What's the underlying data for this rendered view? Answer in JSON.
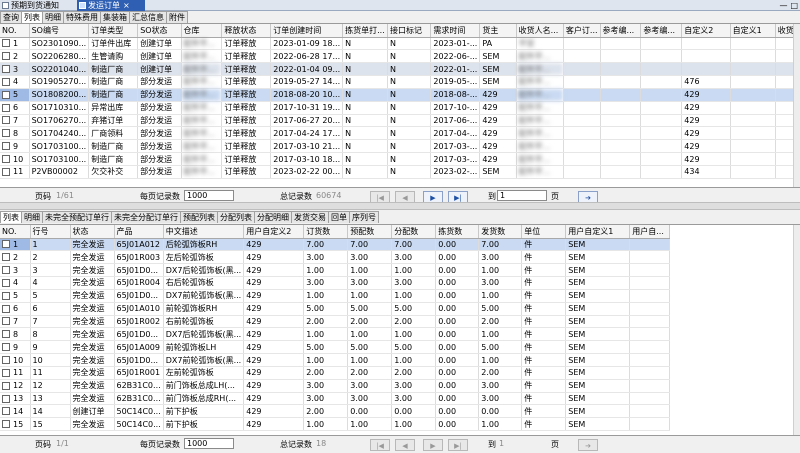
{
  "doc_tabs": [
    {
      "label": "预期到货通知",
      "active": false
    },
    {
      "label": "发运订单",
      "active": true
    }
  ],
  "top_subtabs": [
    "查询",
    "列表",
    "明细",
    "特殊费用",
    "集装箱",
    "汇总信息",
    "附件"
  ],
  "top_grid": {
    "columns": [
      "NO.",
      "SO编号",
      "订单类型",
      "SO状态",
      "仓库",
      "释放状态",
      "订单创建时间",
      "拣货单打...",
      "接口标记",
      "需求时间",
      "货主",
      "收货人名...",
      "客户订...",
      "参考编...",
      "参考编...",
      "自定义2",
      "自定义1",
      "收货"
    ],
    "rows": [
      [
        "1",
        "SO2301090...",
        "订单件出库",
        "创建订单",
        "配件平...",
        "订单释放",
        "2023-01-09 18...",
        "N",
        "N",
        "2023-01-...",
        "PA",
        "平安",
        "",
        "",
        "",
        "",
        "",
        ""
      ],
      [
        "2",
        "SO2206280...",
        "生管请购",
        "创建订单",
        "配件平...",
        "订单释放",
        "2022-06-28 17...",
        "N",
        "N",
        "2022-06-...",
        "SEM",
        "配件平...",
        "",
        "",
        "",
        "",
        "",
        ""
      ],
      [
        "3",
        "SO2201040...",
        "制造厂商",
        "创建订单",
        "配件平...",
        "订单释放",
        "2022-01-04 09...",
        "N",
        "N",
        "2022-01-...",
        "SEM",
        "配件平...",
        "",
        "",
        "",
        "",
        "",
        ""
      ],
      [
        "4",
        "SO1905270...",
        "制造厂商",
        "部分发运",
        "配件平...",
        "订单释放",
        "2019-05-27 14...",
        "N",
        "N",
        "2019-05-...",
        "SEM",
        "配件平...",
        "",
        "",
        "",
        "476",
        "",
        ""
      ],
      [
        "5",
        "SO1808200...",
        "制造厂商",
        "部分发运",
        "配件平...",
        "订单释放",
        "2018-08-20 10...",
        "N",
        "N",
        "2018-08-...",
        "429",
        "配件平...",
        "",
        "",
        "",
        "429",
        "",
        ""
      ],
      [
        "6",
        "SO1710310...",
        "异常出库",
        "部分发运",
        "配件平...",
        "订单释放",
        "2017-10-31 19...",
        "N",
        "N",
        "2017-10-...",
        "429",
        "配件平...",
        "",
        "",
        "",
        "429",
        "",
        ""
      ],
      [
        "7",
        "SO1706270...",
        "弃猪订单",
        "部分发运",
        "配件平...",
        "订单释放",
        "2017-06-27 20...",
        "N",
        "N",
        "2017-06-...",
        "429",
        "配件平...",
        "",
        "",
        "",
        "429",
        "",
        ""
      ],
      [
        "8",
        "SO1704240...",
        "厂商领料",
        "部分发运",
        "配件平...",
        "订单释放",
        "2017-04-24 17...",
        "N",
        "N",
        "2017-04-...",
        "429",
        "配件平...",
        "",
        "",
        "",
        "429",
        "",
        ""
      ],
      [
        "9",
        "SO1703100...",
        "制造厂商",
        "部分发运",
        "配件平...",
        "订单释放",
        "2017-03-10 21...",
        "N",
        "N",
        "2017-03-...",
        "429",
        "配件平...",
        "",
        "",
        "",
        "429",
        "",
        ""
      ],
      [
        "10",
        "SO1703100...",
        "制造厂商",
        "部分发运",
        "配件平...",
        "订单释放",
        "2017-03-10 18...",
        "N",
        "N",
        "2017-03-...",
        "429",
        "配件平...",
        "",
        "",
        "",
        "429",
        "",
        ""
      ],
      [
        "11",
        "P2VB00002",
        "欠交补交",
        "部分发运",
        "配件平...",
        "订单释放",
        "2023-02-22 00...",
        "N",
        "N",
        "2023-02-...",
        "SEM",
        "配件平...",
        "",
        "",
        "",
        "434",
        "",
        ""
      ]
    ]
  },
  "top_pager": {
    "page_label": "页码",
    "page_value": "1/61",
    "per_page_label": "每页记录数",
    "per_page_value": "1000",
    "total_label": "总记录数",
    "total_value": "60674",
    "goto_label": "到",
    "goto_value": "1",
    "page_suffix": "页"
  },
  "bottom_subtabs": [
    "列表",
    "明细",
    "未完全预配订单行",
    "未完全分配订单行",
    "预配列表",
    "分配列表",
    "分配明细",
    "发货交易",
    "回单",
    "序列号"
  ],
  "bottom_grid": {
    "columns": [
      "NO.",
      "行号",
      "状态",
      "产品",
      "中文描述",
      "用户自定义2",
      "订货数",
      "预配数",
      "分配数",
      "拣货数",
      "发货数",
      "单位",
      "用户自定义1",
      "用户自..."
    ],
    "rows": [
      [
        "1",
        "1",
        "完全发运",
        "65J01A012",
        "后轮弧饰板RH",
        "429",
        "7.00",
        "7.00",
        "7.00",
        "0.00",
        "7.00",
        "件",
        "SEM",
        ""
      ],
      [
        "2",
        "2",
        "完全发运",
        "65J01R003",
        "左后轮弧饰板",
        "429",
        "3.00",
        "3.00",
        "3.00",
        "0.00",
        "3.00",
        "件",
        "SEM",
        ""
      ],
      [
        "3",
        "3",
        "完全发运",
        "65J01D0...",
        "DX7后轮弧饰板(黑...",
        "429",
        "1.00",
        "1.00",
        "1.00",
        "0.00",
        "1.00",
        "件",
        "SEM",
        ""
      ],
      [
        "4",
        "4",
        "完全发运",
        "65J01R004",
        "右后轮弧饰板",
        "429",
        "3.00",
        "3.00",
        "3.00",
        "0.00",
        "3.00",
        "件",
        "SEM",
        ""
      ],
      [
        "5",
        "5",
        "完全发运",
        "65J01D0...",
        "DX7前轮弧饰板(黑...",
        "429",
        "1.00",
        "1.00",
        "1.00",
        "0.00",
        "1.00",
        "件",
        "SEM",
        ""
      ],
      [
        "6",
        "6",
        "完全发运",
        "65J01A010",
        "前轮弧饰板RH",
        "429",
        "5.00",
        "5.00",
        "5.00",
        "0.00",
        "5.00",
        "件",
        "SEM",
        ""
      ],
      [
        "7",
        "7",
        "完全发运",
        "65J01R002",
        "右前轮弧饰板",
        "429",
        "2.00",
        "2.00",
        "2.00",
        "0.00",
        "2.00",
        "件",
        "SEM",
        ""
      ],
      [
        "8",
        "8",
        "完全发运",
        "65J01D0...",
        "DX7后轮弧饰板(黑...",
        "429",
        "1.00",
        "1.00",
        "1.00",
        "0.00",
        "1.00",
        "件",
        "SEM",
        ""
      ],
      [
        "9",
        "9",
        "完全发运",
        "65J01A009",
        "前轮弧饰板LH",
        "429",
        "5.00",
        "5.00",
        "5.00",
        "0.00",
        "5.00",
        "件",
        "SEM",
        ""
      ],
      [
        "10",
        "10",
        "完全发运",
        "65J01D0...",
        "DX7前轮弧饰板(黑...",
        "429",
        "1.00",
        "1.00",
        "1.00",
        "0.00",
        "1.00",
        "件",
        "SEM",
        ""
      ],
      [
        "11",
        "11",
        "完全发运",
        "65J01R001",
        "左前轮弧饰板",
        "429",
        "2.00",
        "2.00",
        "2.00",
        "0.00",
        "2.00",
        "件",
        "SEM",
        ""
      ],
      [
        "12",
        "12",
        "完全发运",
        "62B31C0...",
        "前门饰板总成LH(...",
        "429",
        "3.00",
        "3.00",
        "3.00",
        "0.00",
        "3.00",
        "件",
        "SEM",
        ""
      ],
      [
        "13",
        "13",
        "完全发运",
        "62B31C0...",
        "前门饰板总成RH(...",
        "429",
        "3.00",
        "3.00",
        "3.00",
        "0.00",
        "3.00",
        "件",
        "SEM",
        ""
      ],
      [
        "14",
        "14",
        "创建订单",
        "50C14C0...",
        "前下护板",
        "429",
        "2.00",
        "0.00",
        "0.00",
        "0.00",
        "0.00",
        "件",
        "SEM",
        ""
      ],
      [
        "15",
        "15",
        "完全发运",
        "50C14C0...",
        "前下护板",
        "429",
        "1.00",
        "1.00",
        "1.00",
        "0.00",
        "1.00",
        "件",
        "SEM",
        ""
      ]
    ]
  },
  "bottom_pager": {
    "page_label": "页码",
    "page_value": "1/1",
    "per_page_label": "每页记录数",
    "per_page_value": "1000",
    "total_label": "总记录数",
    "total_value": "18",
    "goto_label": "到",
    "goto_value": "1",
    "page_suffix": "页"
  },
  "nav_glyphs": {
    "first": "|◀",
    "prev": "◀",
    "next": "▶",
    "last": "▶|",
    "go": "➔"
  },
  "window_controls": {
    "minimize": "—",
    "maximize": "□"
  },
  "colors": {
    "active_tab": "#2f5fb3",
    "selected_row": "#c9daf2",
    "go_arrow": "#1d4fa5"
  }
}
